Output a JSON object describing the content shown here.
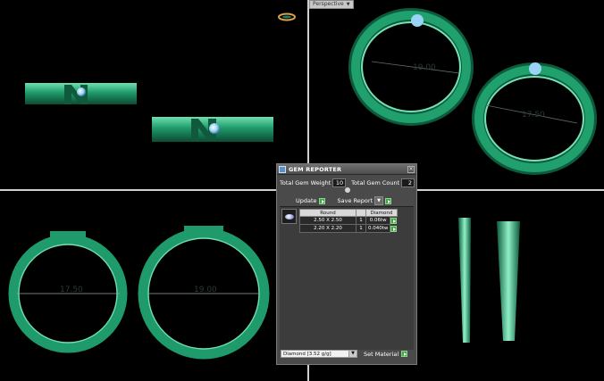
{
  "viewport": {
    "label": "Perspective",
    "dims_perspective": [
      "19.00",
      "17.50"
    ],
    "dims_front": [
      "17.50",
      "19.00"
    ]
  },
  "colors": {
    "ring_green": "#1f9a6a",
    "ring_dark": "#0d4a33",
    "ring_light": "#6fe0b0"
  },
  "gem_reporter": {
    "title": "GEM REPORTER",
    "total_gem_weight_label": "Total Gem Weight",
    "total_gem_weight": "10",
    "total_gem_count_label": "Total Gem Count",
    "total_gem_count": "2",
    "update_label": "Update",
    "save_report_label": "Save Report",
    "columns": [
      "Round",
      "Diamond"
    ],
    "rows": [
      {
        "size": "2.50 X 2.50",
        "count": "1",
        "weight": "0.06tw"
      },
      {
        "size": "2.20 X 2.20",
        "count": "1",
        "weight": "0.040tw"
      }
    ],
    "material_value": "Diamond    [3.52 g/g]",
    "set_material_label": "Set Material"
  },
  "icons": [
    "gem-reporter-icon",
    "close-icon",
    "diamond-thumbnail-icon",
    "chevron-down-icon",
    "go-arrow-icon"
  ]
}
